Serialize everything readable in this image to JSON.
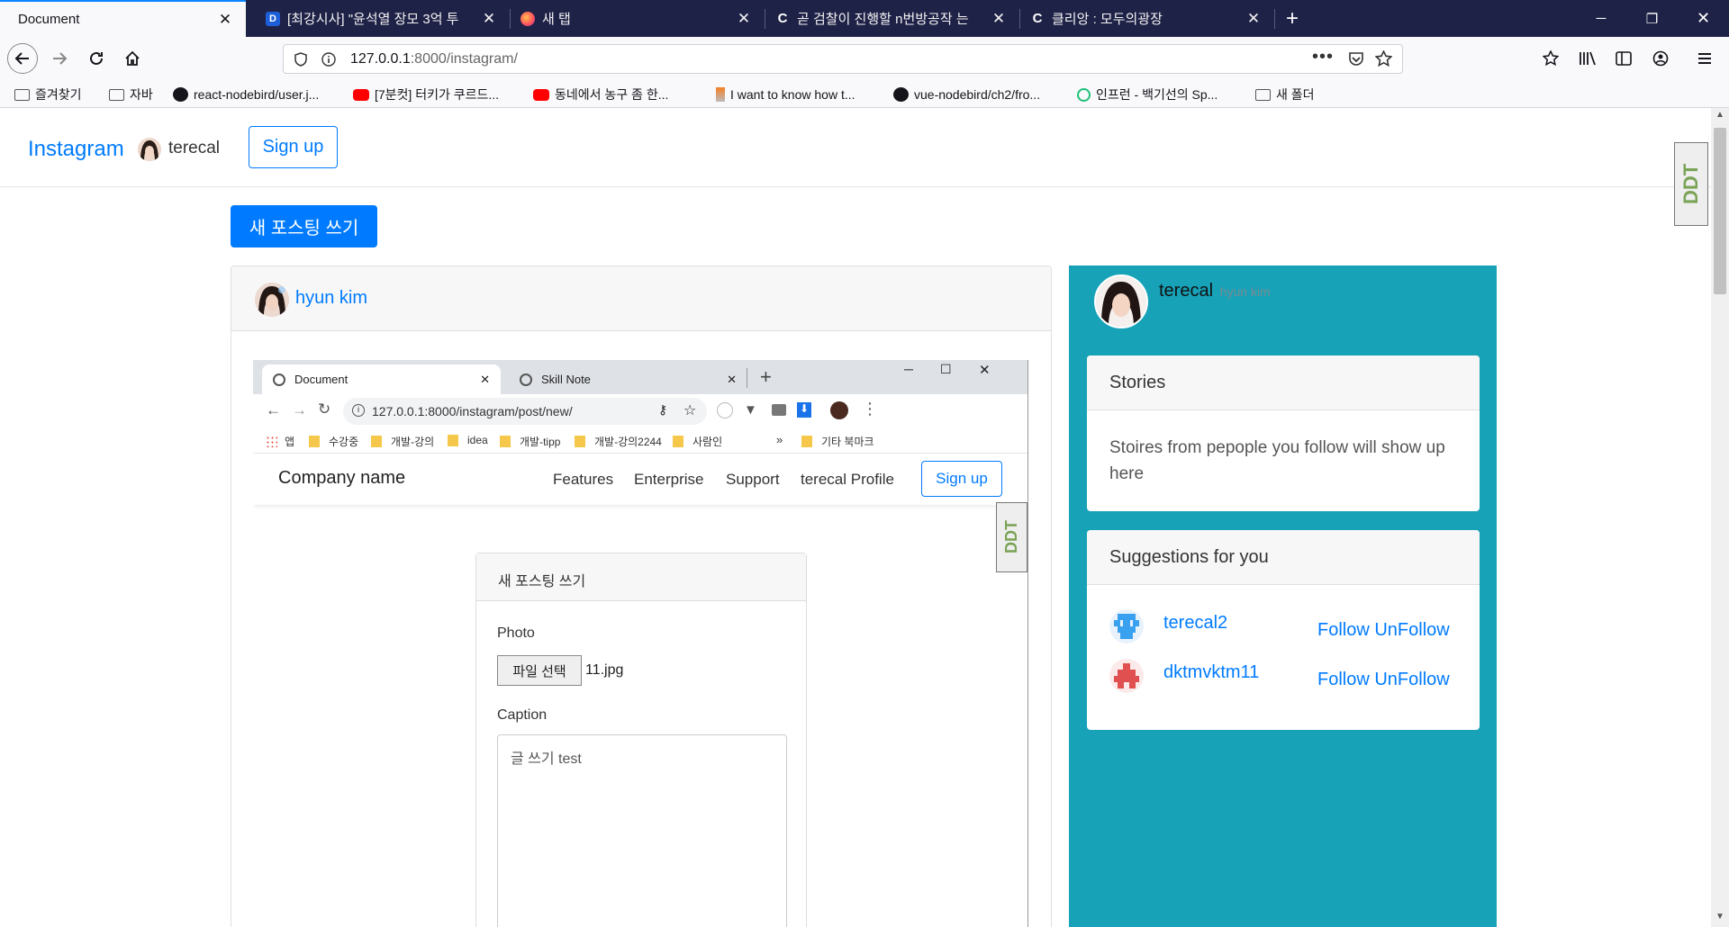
{
  "browser": {
    "tabs": [
      {
        "title": "Document",
        "favicon": "document-favicon"
      },
      {
        "title": "[최강시사] \"윤석열 장모 3억 투",
        "favicon": "daum-favicon"
      },
      {
        "title": "새 탭",
        "favicon": "firefox-favicon"
      },
      {
        "title": "곧 검찰이 진행할 n번방공작 는",
        "favicon": "clien-favicon"
      },
      {
        "title": "클리앙 : 모두의광장",
        "favicon": "clien-favicon"
      }
    ],
    "url_host": "127.0.0.1",
    "url_rest": ":8000/instagram/",
    "bookmarks": [
      {
        "label": "즐겨찾기",
        "icon": "folder-icon"
      },
      {
        "label": "자바",
        "icon": "folder-icon"
      },
      {
        "label": "react-nodebird/user.j...",
        "icon": "github-icon"
      },
      {
        "label": "[7분컷] 터키가 쿠르드...",
        "icon": "youtube-icon"
      },
      {
        "label": "동네에서 농구 좀 한...",
        "icon": "youtube-icon"
      },
      {
        "label": "I want to know how t...",
        "icon": "stackoverflow-icon"
      },
      {
        "label": "vue-nodebird/ch2/fro...",
        "icon": "github-icon"
      },
      {
        "label": "인프런 - 백기선의 Sp...",
        "icon": "inflearn-icon"
      },
      {
        "label": "새 폴더",
        "icon": "folder-icon"
      }
    ]
  },
  "site": {
    "brand": "Instagram",
    "username": "terecal",
    "signup": "Sign up",
    "new_post_button": "새 포스팅 쓰기",
    "post_author": "hyun kim"
  },
  "embedded": {
    "tabs": [
      "Document",
      "Skill Note"
    ],
    "url": "127.0.0.1:8000/instagram/post/new/",
    "bookmarks": [
      "앱",
      "수강중",
      "개발-강의",
      "idea",
      "개발-tipp",
      "개발-강의2244",
      "사람인",
      "기타 북마크"
    ],
    "company": "Company name",
    "nav": [
      "Features",
      "Enterprise",
      "Support",
      "terecal Profile"
    ],
    "signup": "Sign up",
    "form_title": "새 포스팅 쓰기",
    "photo_label": "Photo",
    "file_button": "파일 선택",
    "file_name": "11.jpg",
    "caption_label": "Caption",
    "caption_value": "글 쓰기 test"
  },
  "sidebar": {
    "username": "terecal",
    "fullname": "hyun kim",
    "stories_title": "Stories",
    "stories_body": "Stoires from pepople you follow will show up here",
    "suggestions_title": "Suggestions for you",
    "suggestions": [
      {
        "name": "terecal2",
        "follow": "Follow",
        "unfollow": "UnFollow",
        "color": "#3aa0f0"
      },
      {
        "name": "dktmvktm11",
        "follow": "Follow",
        "unfollow": "UnFollow",
        "color": "#e05050"
      }
    ]
  },
  "colors": {
    "primary": "#007bff",
    "sidebar": "#17a2b8",
    "firefox_tabbar": "#1f2247"
  }
}
